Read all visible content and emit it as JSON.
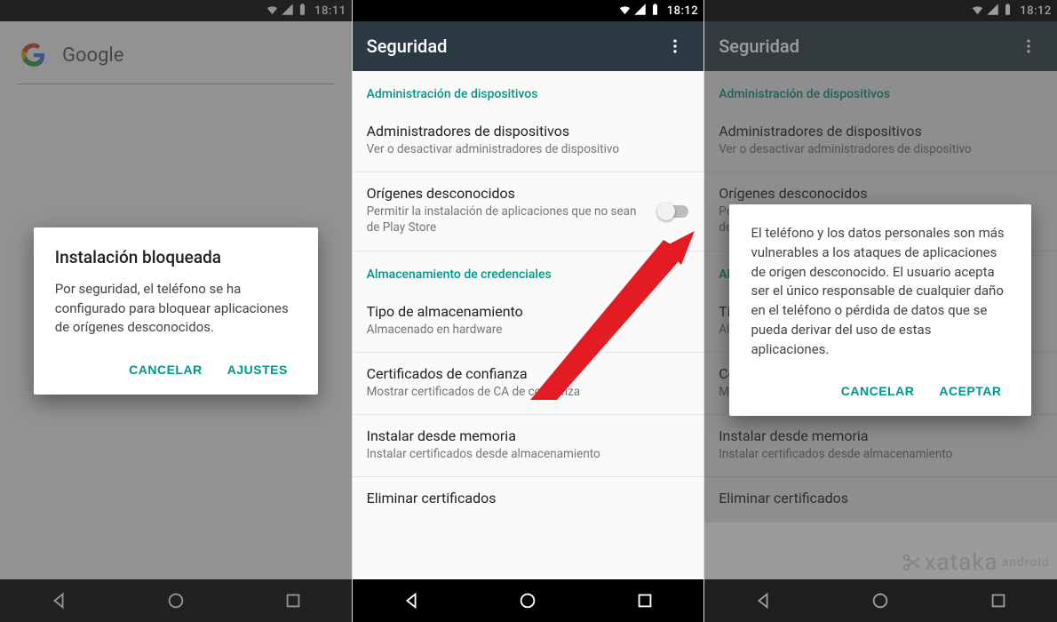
{
  "screens": [
    {
      "statusbar": {
        "time": "18:11"
      },
      "search": {
        "label": "Google"
      },
      "dialog": {
        "title": "Instalación bloqueada",
        "body": "Por seguridad, el teléfono se ha configurado para bloquear aplicaciones de orígenes desconocidos.",
        "cancel": "CANCELAR",
        "accept": "AJUSTES"
      }
    },
    {
      "statusbar": {
        "time": "18:12"
      },
      "appbar": {
        "title": "Seguridad"
      },
      "sections": {
        "device_admin_header": "Administración de dispositivos",
        "device_admin_title": "Administradores de dispositivos",
        "device_admin_sub": "Ver o desactivar administradores de dispositivo",
        "unknown_title": "Orígenes desconocidos",
        "unknown_sub": "Permitir la instalación de aplicaciones que no sean de Play Store",
        "cred_header": "Almacenamiento de credenciales",
        "storage_title": "Tipo de almacenamiento",
        "storage_sub": "Almacenado en hardware",
        "trusted_title": "Certificados de confianza",
        "trusted_sub": "Mostrar certificados de CA de confianza",
        "install_title": "Instalar desde memoria",
        "install_sub": "Instalar certificados desde almacenamiento",
        "clear_title": "Eliminar certificados"
      }
    },
    {
      "statusbar": {
        "time": "18:12"
      },
      "appbar": {
        "title": "Seguridad"
      },
      "dialog": {
        "body": "El teléfono y los datos personales son más vulnerables a los ataques de aplicaciones de origen desconocido. El usuario acepta ser el único responsable de cualquier daño en el teléfono o pérdida de datos que se pueda derivar del uso de estas aplicaciones.",
        "cancel": "CANCELAR",
        "accept": "ACEPTAR"
      },
      "sections": {
        "device_admin_header": "Administración de dispositivos",
        "device_admin_title": "Administradores de dispositivos",
        "device_admin_sub": "Ver o desactivar administradores de dispositivo",
        "unknown_title": "Orígenes desconocidos",
        "unknown_sub": "Permitir la instalación de aplicaciones que no sean de Play Store",
        "cred_header": "Almacenamiento de credenciales",
        "storage_title": "Tipo de almacenamiento",
        "storage_sub": "Almacenado en hardware",
        "trusted_title": "Certificados de confianza",
        "trusted_sub": "Mostrar certificados de CA de confianza",
        "install_title": "Instalar desde memoria",
        "install_sub": "Instalar certificados desde almacenamiento",
        "clear_title": "Eliminar certificados"
      }
    }
  ],
  "watermark": {
    "main": "xataka",
    "sub": "android"
  },
  "colors": {
    "accent": "#009688"
  }
}
